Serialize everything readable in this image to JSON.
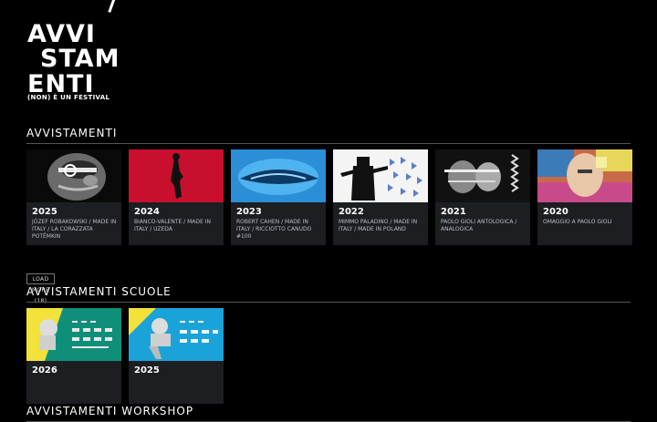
{
  "logo": {
    "line1": "AVVI",
    "line2": "STAM",
    "line3": "ENTI",
    "tagline": "(NON) È UN FESTIVAL"
  },
  "sections": {
    "main": {
      "title": "AVVISTAMENTI",
      "cards": [
        {
          "year": "2025",
          "desc": "JÓZEF ROBAKOWSKI / MADE IN ITALY / LA CORAZZATA POTËMKIN"
        },
        {
          "year": "2024",
          "desc": "BIANCO-VALENTE / MADE IN ITALY / UZEDA"
        },
        {
          "year": "2023",
          "desc": "ROBERT CAHEN / MADE IN ITALY / RICCIOTTO CANUDO #100"
        },
        {
          "year": "2022",
          "desc": "MIMMO PALADINO / MADE IN ITALY / MADE IN POLAND"
        },
        {
          "year": "2021",
          "desc": "PAOLO GIOLI ANTOLOGICA / ANALOGICA"
        },
        {
          "year": "2020",
          "desc": "OMAGGIO A PAOLO GIOLI"
        }
      ],
      "load_more": "LOAD MORE (18)"
    },
    "schools": {
      "title": "AVVISTAMENTI SCUOLE",
      "cards": [
        {
          "year": "2026",
          "desc": ""
        },
        {
          "year": "2025",
          "desc": ""
        }
      ]
    },
    "workshop": {
      "title": "AVVISTAMENTI WORKSHOP"
    }
  },
  "colors": {
    "background": "#000000",
    "card_bg": "#1c1e22",
    "red_thumb": "#c8102e",
    "blue_thumb": "#2a8fd6"
  }
}
